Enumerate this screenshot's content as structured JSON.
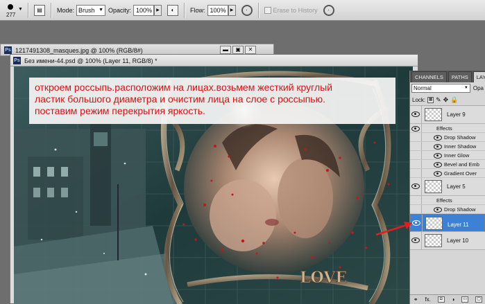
{
  "options_bar": {
    "brush_size": "277",
    "mode_label": "Mode:",
    "mode_value": "Brush",
    "opacity_label": "Opacity:",
    "opacity_value": "100%",
    "flow_label": "Flow:",
    "flow_value": "100%",
    "erase_to_history": "Erase to History"
  },
  "back_document": {
    "title": "1217491308_masques.jpg @ 100% (RGB/8#)"
  },
  "front_document": {
    "title": "Без имени-44.psd @ 100% (Layer 11, RGB/8) *",
    "love_text": "LOVE"
  },
  "annotation": {
    "lines": [
      "откроем россыпь.расположим на лицах.возьмем жесткий круглый",
      "ластик большого диаметра и очистим лица на слое с россыпью.",
      "поставим режим перекрытия яркость."
    ]
  },
  "layers_panel": {
    "tabs": [
      "CHANNELS",
      "PATHS",
      "LAYE"
    ],
    "blend_mode": "Normal",
    "opacity_label": "Opa",
    "lock_label": "Lock:",
    "layers": [
      {
        "name": "Layer 9",
        "selected": false,
        "fx": false
      },
      {
        "name": "Effects",
        "type": "effects"
      },
      {
        "name": "Drop Shadow",
        "type": "effect"
      },
      {
        "name": "Inner Shadow",
        "type": "effect"
      },
      {
        "name": "Inner Glow",
        "type": "effect"
      },
      {
        "name": "Bevel and Emb",
        "type": "effect"
      },
      {
        "name": "Gradient Over",
        "type": "effect"
      },
      {
        "name": "Layer 5",
        "selected": false,
        "fx": false
      },
      {
        "name": "Effects",
        "type": "effects"
      },
      {
        "name": "Drop Shadow",
        "type": "effect"
      },
      {
        "name": "Layer 11",
        "selected": true,
        "fx": false
      },
      {
        "name": "Layer 10",
        "selected": false,
        "fx": false
      }
    ],
    "footer_fx": "fx."
  },
  "colors": {
    "annotation_text": "#e10e0e",
    "selected_layer": "#3d81d6",
    "arrow": "#e02020"
  }
}
